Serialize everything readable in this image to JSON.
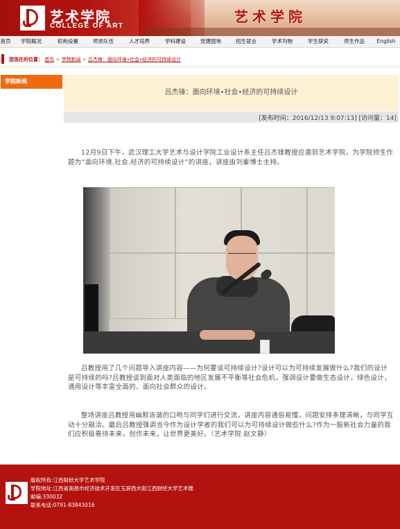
{
  "header": {
    "logo_cn": "艺术学院",
    "logo_en": "COLLEGE OF ART",
    "banner_title": "艺术学院"
  },
  "nav": {
    "items": [
      {
        "label": "首页"
      },
      {
        "label": "学院概况"
      },
      {
        "label": "机构设置"
      },
      {
        "label": "师资队伍"
      },
      {
        "label": "人才培养"
      },
      {
        "label": "学科建设"
      },
      {
        "label": "党建园地"
      },
      {
        "label": "招生就业"
      },
      {
        "label": "学术刊物"
      },
      {
        "label": "学生获奖"
      },
      {
        "label": "师生作品"
      },
      {
        "label": "English"
      }
    ]
  },
  "breadcrumb": {
    "prefix": "您现在的位置：",
    "items": [
      "首页",
      "学院新闻",
      "吕杰锋：面向环境•社会•经济的可持续设计"
    ],
    "separator": ">"
  },
  "sidebar": {
    "section_label": "学院新闻"
  },
  "article": {
    "title": "吕杰锋：面向环境•社会•经济的可持续设计",
    "meta": "[发布时间：2016/12/13 9:07:13] [访问量：14]",
    "paragraphs": [
      "12月9日下午，武汉理工大学艺术与设计学院工业设计系主任吕杰锋教授应邀到艺术学院，为学院师生作题为“面向环境.社会.经济的可持续设计”的讲座，讲座由刘秦博士主持。",
      "吕教授用了几个问题导入讲座内容——为何要谈可持续设计?设计可以为可持续发展做什么?我们的设计是可持续的吗?吕教授谈到面对人类面临的地区发展不平衡等社会危机，强调设计要做生态设计，绿色设计，通用设计等丰富全面的、面向社会群众的设计。",
      "整场讲座吕教授用幽默诙谐的口吻与同学们进行交流，讲座内容通俗易懂，问题安排条理清晰，与同学互动十分融洽。最后吕教授强调当今作为设计学者的我们可以为可持续设计做些什么?作为一股新社会力量的我们应积极看待未来，创作未来，让世界更美好。（艺术学院  赵文静）"
    ]
  },
  "footer": {
    "copyright": "版权所有:江西财经大学艺术学院",
    "address": "学院地址:江西省南昌市经济技术开发区玉屏西大街江西财经大学艺术楼",
    "postcode": "邮编:330032",
    "phone": "联系电话:0791-83843016"
  },
  "colors": {
    "brand_red": "#b3120f",
    "sidebar_orange": "#f06a0f",
    "title_box_bg": "#fdf3d4",
    "meta_bar_bg": "#e6e6e6"
  }
}
